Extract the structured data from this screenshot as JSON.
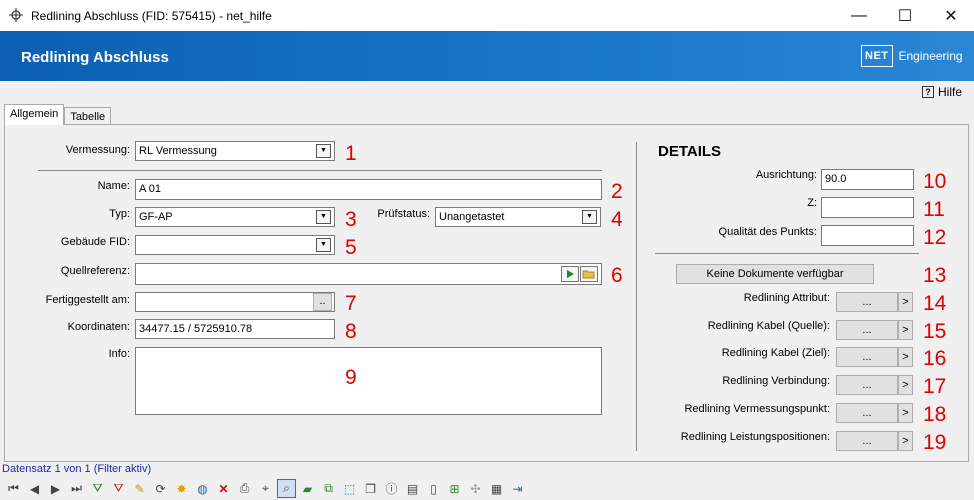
{
  "window": {
    "title": "Redlining Abschluss (FID: 575415) - net_hilfe",
    "minimize": "—",
    "maximize": "☐",
    "close": "✕"
  },
  "header": {
    "title": "Redlining Abschluss",
    "logo_box": "NET",
    "logo_text": "Engineering"
  },
  "help": {
    "icon": "?",
    "label": "Hilfe"
  },
  "tabs": [
    {
      "label": "Allgemein",
      "active": true
    },
    {
      "label": "Tabelle",
      "active": false
    }
  ],
  "form": {
    "vermessung": {
      "label": "Vermessung:",
      "value": "RL Vermessung",
      "marker": "1"
    },
    "name": {
      "label": "Name:",
      "value": "A 01",
      "marker": "2"
    },
    "typ": {
      "label": "Typ:",
      "value": "GF-AP",
      "marker": "3"
    },
    "pruefstatus": {
      "label": "Prüfstatus:",
      "value": "Unangetastet",
      "marker": "4"
    },
    "gebaeude": {
      "label": "Gebäude FID:",
      "value": "",
      "marker": "5"
    },
    "quellreferenz": {
      "label": "Quellreferenz:",
      "value": "",
      "marker": "6"
    },
    "fertiggestellt": {
      "label": "Fertiggestellt am:",
      "value": "",
      "btn": "..",
      "marker": "7"
    },
    "koordinaten": {
      "label": "Koordinaten:",
      "value": "34477.15 / 5725910.78",
      "marker": "8"
    },
    "info": {
      "label": "Info:",
      "value": "",
      "marker": "9"
    }
  },
  "details": {
    "title": "DETAILS",
    "ausrichtung": {
      "label": "Ausrichtung:",
      "value": "90.0",
      "marker": "10"
    },
    "z": {
      "label": "Z:",
      "value": "",
      "marker": "11"
    },
    "qualitaet": {
      "label": "Qualität des Punkts:",
      "value": "",
      "marker": "12"
    },
    "dokumente": {
      "label": "Keine Dokumente verfügbar",
      "marker": "13"
    },
    "links": [
      {
        "label": "Redlining Attribut:",
        "btn": "...",
        "arrow": ">",
        "marker": "14"
      },
      {
        "label": "Redlining Kabel (Quelle):",
        "btn": "...",
        "arrow": ">",
        "marker": "15"
      },
      {
        "label": "Redlining Kabel (Ziel):",
        "btn": "...",
        "arrow": ">",
        "marker": "16"
      },
      {
        "label": "Redlining Verbindung:",
        "btn": "...",
        "arrow": ">",
        "marker": "17"
      },
      {
        "label": "Redlining Vermessungspunkt:",
        "btn": "...",
        "arrow": ">",
        "marker": "18"
      },
      {
        "label": "Redlining Leistungspositionen:",
        "btn": "...",
        "arrow": ">",
        "marker": "19"
      }
    ]
  },
  "status": "Datensatz 1 von 1 (Filter aktiv)",
  "toolbar_icons": [
    "first-record-icon",
    "prev-record-icon",
    "next-record-icon",
    "last-record-icon",
    "filter-add-icon",
    "filter-remove-icon",
    "edit-icon",
    "refresh-icon",
    "highlight-icon",
    "globe-icon",
    "delete-icon",
    "print-icon",
    "select-cursor-icon",
    "zoom-icon",
    "polygon-icon",
    "copy-shapes-icon",
    "select-area-icon",
    "duplicate-icon",
    "info-icon",
    "report-icon",
    "document-icon",
    "map-add-icon",
    "move-icon",
    "table-icon",
    "exit-icon"
  ]
}
